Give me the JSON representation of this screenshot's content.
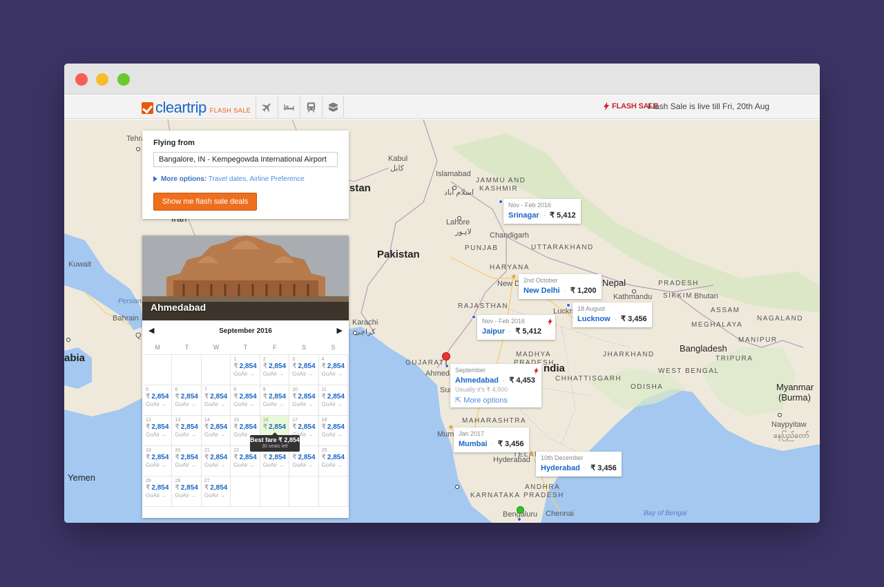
{
  "window": {
    "title_dots": [
      "close",
      "minimize",
      "zoom"
    ]
  },
  "brand": {
    "logo_text": "cleartrip",
    "logo_sub": "FLASH SALE"
  },
  "nav": {
    "icons": [
      "airplane-icon",
      "bed-icon",
      "train-icon",
      "package-icon"
    ]
  },
  "flash": {
    "label": "FLASH SALE",
    "message": "Flash Sale is live till Fri, 20th Aug",
    "color": "#d0202e"
  },
  "search": {
    "title": "Flying from",
    "from_value": "Bangalore, IN - Kempegowda International Airport",
    "more_options_label": "More options:",
    "more_options_links": "Travel dates, Airline Preference",
    "button_label": "Show me flash sale deals",
    "button_color": "#ee6f1e"
  },
  "calendar": {
    "city": "Ahmedabad",
    "month": "September 2016",
    "prev": "◀",
    "next": "▶",
    "weekdays": [
      "M",
      "T",
      "W",
      "T",
      "F",
      "S",
      "S"
    ],
    "currency": "₹",
    "days": [
      {
        "n": "",
        "p": "",
        "a": ""
      },
      {
        "n": "",
        "p": "",
        "a": ""
      },
      {
        "n": "",
        "p": "",
        "a": ""
      },
      {
        "n": "1",
        "p": "2,854",
        "a": "GoAir →"
      },
      {
        "n": "2",
        "p": "2,854",
        "a": "GoAir →"
      },
      {
        "n": "3",
        "p": "2,854",
        "a": "GoAir →"
      },
      {
        "n": "4",
        "p": "2,854",
        "a": "GoAir →"
      },
      {
        "n": "5",
        "p": "2,854",
        "a": "GoAir →"
      },
      {
        "n": "6",
        "p": "2,854",
        "a": "GoAir →"
      },
      {
        "n": "7",
        "p": "2,854",
        "a": "GoAir →"
      },
      {
        "n": "8",
        "p": "2,854",
        "a": "GoAir →"
      },
      {
        "n": "9",
        "p": "2,854",
        "a": "GoAir →"
      },
      {
        "n": "10",
        "p": "2,854",
        "a": "GoAir →"
      },
      {
        "n": "11",
        "p": "2,854",
        "a": "GoAir →"
      },
      {
        "n": "12",
        "p": "2,854",
        "a": "GoAir →"
      },
      {
        "n": "13",
        "p": "2,854",
        "a": "GoAir →"
      },
      {
        "n": "14",
        "p": "2,854",
        "a": "GoAir →"
      },
      {
        "n": "15",
        "p": "2,854",
        "a": "GoAir →"
      },
      {
        "n": "16",
        "p": "2,854",
        "a": "",
        "best": true
      },
      {
        "n": "17",
        "p": "2,854",
        "a": "GoAir →"
      },
      {
        "n": "18",
        "p": "2,854",
        "a": "GoAir →"
      },
      {
        "n": "19",
        "p": "2,854",
        "a": "GoAir →"
      },
      {
        "n": "20",
        "p": "2,854",
        "a": "GoAir →"
      },
      {
        "n": "21",
        "p": "2,854",
        "a": "GoAir →"
      },
      {
        "n": "22",
        "p": "2,854",
        "a": "GoAir →"
      },
      {
        "n": "23",
        "p": "2,854",
        "a": "GoAir →"
      },
      {
        "n": "24",
        "p": "2,854",
        "a": "GoAir →"
      },
      {
        "n": "25",
        "p": "2,854",
        "a": "GoAir →"
      },
      {
        "n": "26",
        "p": "2,854",
        "a": "GoAir →"
      },
      {
        "n": "26",
        "p": "2,854",
        "a": "GoAir →"
      },
      {
        "n": "27",
        "p": "2,854",
        "a": "GoAir →"
      },
      {
        "n": "",
        "p": "",
        "a": ""
      },
      {
        "n": "",
        "p": "",
        "a": ""
      },
      {
        "n": "",
        "p": "",
        "a": ""
      },
      {
        "n": "",
        "p": "",
        "a": ""
      }
    ],
    "tooltip": {
      "main": "Best fare ₹ 2,854",
      "sub": "30 seats left"
    }
  },
  "fares": [
    {
      "date": "Nov - Feb 2016",
      "city": "Srinagar",
      "price": "₹ 5,412"
    },
    {
      "date": "2nd October",
      "city": "New Delhi",
      "price": "₹ 1,200"
    },
    {
      "date": "18 August",
      "city": "Lucknow",
      "price": "₹ 3,456"
    },
    {
      "date": "Nov - Feb 2016",
      "city": "Jaipur",
      "price": "₹ 5,412"
    },
    {
      "date": "September",
      "city": "Ahmedabad",
      "price": "₹ 4,453",
      "note": "Usually it's ₹ 4,500",
      "more": "More options"
    },
    {
      "date": "Jan 2017",
      "city": "Mumbai",
      "price": "₹ 3,456"
    },
    {
      "date": "10th December",
      "city": "Hyderabad",
      "price": "₹ 3,456"
    }
  ],
  "map_labels": {
    "tehran": "Tehra",
    "iran": "Iran",
    "kuwait": "Kuwait",
    "persian": "Persian",
    "bahrain": "Bahrain",
    "qa": "Q",
    "abia": "abia",
    "yemen": "Yemen",
    "kabul": "Kabul",
    "kabul_ar": "کابل",
    "islamabad": "Islamabad",
    "islamabad_ar": "اسلام آباد",
    "stan": "stan",
    "jk": "JAMMU AND",
    "kashmir": "KASHMIR",
    "lahore": "Lahore",
    "lahore_ar": "لاہور",
    "pakistan": "Pakistan",
    "punjab": "PUNJAB",
    "chandigarh": "Chandigarh",
    "uttarakhand": "UTTARAKHAND",
    "haryana": "HARYANA",
    "newd": "New D",
    "nepal": "Nepal",
    "pradesh": "PRADESH",
    "kathmandu": "Kathmandu",
    "sikkim": "SIKKIM",
    "bhutan": "Bhutan",
    "rajasthan": "RAJASTHAN",
    "karachi": "Karachi",
    "karachi_ar": "کراچی",
    "luckn": "Luckn",
    "assam": "ASSAM",
    "meghalaya": "MEGHALAYA",
    "nagaland": "NAGALAND",
    "bangladesh": "Bangladesh",
    "manipur": "MANIPUR",
    "tripura": "TRIPURA",
    "gujarat": "GUJARAT",
    "ahmed": "Ahmeda",
    "madhya": "MADHYA",
    "pradesh2": "PRADESH",
    "india": "ndia",
    "jharkhand": "JHARKHAND",
    "chhattisgarh": "CHHATTISGARH",
    "wb": "WEST BENGAL",
    "odisha": "ODISHA",
    "surat": "Sur",
    "maharashtra": "MAHARASHTRA",
    "mumbai": "Mum",
    "myanmar": "Myanmar",
    "burma": "(Burma)",
    "naypyitaw": "Naypyitaw",
    "naypyitaw_my": "နေပြည်တော်",
    "hyderabad": "Hyderabad",
    "telangana": "TELANGANA",
    "andhra": "ANDHRA",
    "pradesh3": "PRADESH",
    "karnataka": "KARNATAKA",
    "bengaluru": "Bengaluru",
    "chennai": "Chennai",
    "bay": "Bay of Bengal"
  }
}
